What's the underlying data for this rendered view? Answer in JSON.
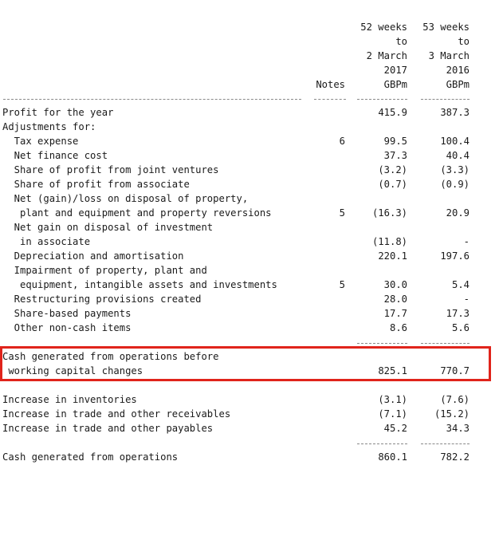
{
  "header": {
    "col_a": [
      "52 weeks",
      "to",
      "2 March",
      "2017",
      "GBPm"
    ],
    "col_b": [
      "53 weeks",
      "to",
      "3 March",
      "2016",
      "GBPm"
    ],
    "notes": "Notes"
  },
  "rows": [
    {
      "label": "Profit for the year",
      "notes": "",
      "a": "415.9",
      "b": "387.3"
    },
    {
      "label": "Adjustments for:",
      "notes": "",
      "a": "",
      "b": ""
    },
    {
      "label": "  Tax expense",
      "notes": "6",
      "a": "99.5",
      "b": "100.4"
    },
    {
      "label": "  Net finance cost",
      "notes": "",
      "a": "37.3",
      "b": "40.4"
    },
    {
      "label": "  Share of profit from joint ventures",
      "notes": "",
      "a": "(3.2)",
      "b": "(3.3)"
    },
    {
      "label": "  Share of profit from associate",
      "notes": "",
      "a": "(0.7)",
      "b": "(0.9)"
    },
    {
      "label": "  Net (gain)/loss on disposal of property,",
      "notes": "",
      "a": "",
      "b": ""
    },
    {
      "label": "   plant and equipment and property reversions",
      "notes": "5",
      "a": "(16.3)",
      "b": "20.9"
    },
    {
      "label": "  Net gain on disposal of investment",
      "notes": "",
      "a": "",
      "b": ""
    },
    {
      "label": "   in associate",
      "notes": "",
      "a": "(11.8)",
      "b": "-"
    },
    {
      "label": "  Depreciation and amortisation",
      "notes": "",
      "a": "220.1",
      "b": "197.6"
    },
    {
      "label": "  Impairment of property, plant and",
      "notes": "",
      "a": "",
      "b": ""
    },
    {
      "label": "   equipment, intangible assets and investments",
      "notes": "5",
      "a": "30.0",
      "b": "5.4"
    },
    {
      "label": "  Restructuring provisions created",
      "notes": "",
      "a": "28.0",
      "b": "-"
    },
    {
      "label": "  Share-based payments",
      "notes": "",
      "a": "17.7",
      "b": "17.3"
    },
    {
      "label": "  Other non-cash items",
      "notes": "",
      "a": "8.6",
      "b": "5.6"
    },
    {
      "label": "Cash generated from operations before",
      "notes": "",
      "a": "",
      "b": ""
    },
    {
      "label": " working capital changes",
      "notes": "",
      "a": "825.1",
      "b": "770.7"
    },
    {
      "label": "Increase in inventories",
      "notes": "",
      "a": "(3.1)",
      "b": "(7.6)"
    },
    {
      "label": "Increase in trade and other receivables",
      "notes": "",
      "a": "(7.1)",
      "b": "(15.2)"
    },
    {
      "label": "Increase in trade and other payables",
      "notes": "",
      "a": "45.2",
      "b": "34.3"
    },
    {
      "label": "Cash generated from operations",
      "notes": "",
      "a": "860.1",
      "b": "782.2"
    }
  ],
  "highlight": {
    "color": "#e0241b"
  }
}
